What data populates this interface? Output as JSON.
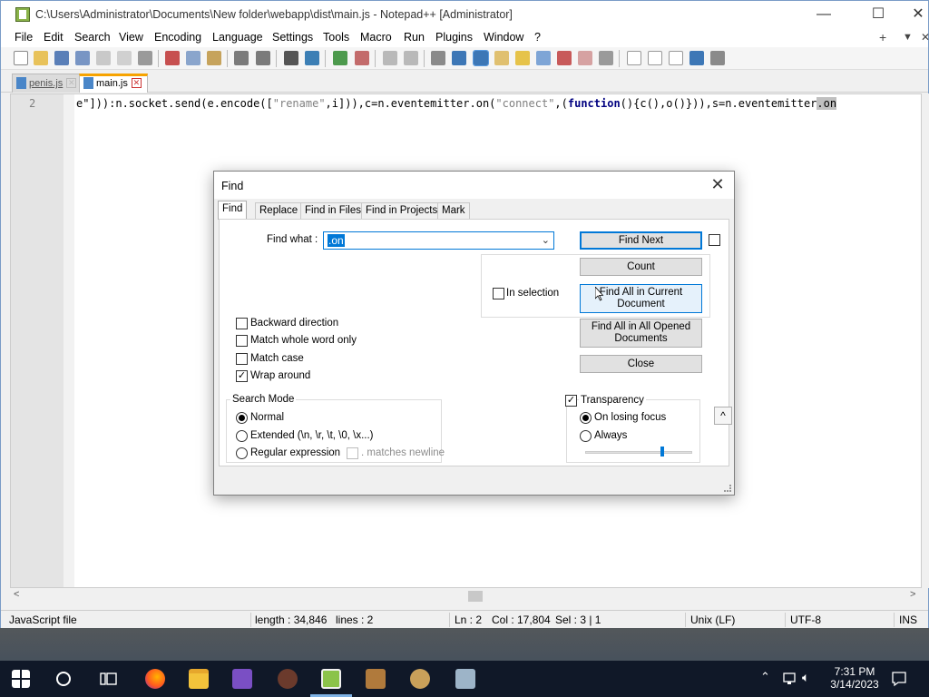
{
  "window": {
    "title": "C:\\Users\\Administrator\\Documents\\New folder\\webapp\\dist\\main.js - Notepad++ [Administrator]",
    "minimize": "—",
    "maximize": "☐",
    "close": "✕"
  },
  "menu": {
    "items": [
      "File",
      "Edit",
      "Search",
      "View",
      "Encoding",
      "Language",
      "Settings",
      "Tools",
      "Macro",
      "Run",
      "Plugins",
      "Window",
      "?"
    ],
    "plus": "+",
    "down": "▼",
    "close": "✕"
  },
  "tabs": [
    {
      "label": "penis.js",
      "active": false
    },
    {
      "label": "main.js",
      "active": true
    }
  ],
  "editor": {
    "line_number": "2",
    "code_prefix": "e\"])):n.socket.send(e.encode([",
    "code_str1": "\"rename\"",
    "code_mid1": ",i])),c=n.eventemitter.on(",
    "code_str2": "\"connect\"",
    "code_mid2": ",(",
    "code_kw": "function",
    "code_mid3": "(){c(),o()})),s=n.eventemitter",
    "code_hl": ".on"
  },
  "statusbar": {
    "filetype": "JavaScript file",
    "length": "length : 34,846",
    "lines": "lines : 2",
    "ln": "Ln : 2",
    "col": "Col : 17,804",
    "sel": "Sel : 3 | 1",
    "eol": "Unix (LF)",
    "encoding": "UTF-8",
    "mode": "INS"
  },
  "find_dialog": {
    "title": "Find",
    "close": "✕",
    "tabs": [
      "Find",
      "Replace",
      "Find in Files",
      "Find in Projects",
      "Mark"
    ],
    "find_what_label": "Find what :",
    "find_what_value": ".on",
    "in_selection": "In selection",
    "backward": "Backward direction",
    "whole_word": "Match whole word only",
    "match_case": "Match case",
    "wrap_around": "Wrap around",
    "search_mode_label": "Search Mode",
    "mode_normal": "Normal",
    "mode_extended": "Extended (\\n, \\r, \\t, \\0, \\x...)",
    "mode_regex": "Regular expression",
    "matches_newline": ". matches newline",
    "transparency": "Transparency",
    "on_losing_focus": "On losing focus",
    "always": "Always",
    "btn_find_next": "Find Next",
    "btn_count": "Count",
    "btn_find_all_current_1": "Find All in Current",
    "btn_find_all_current_2": "Document",
    "btn_find_all_opened_1": "Find All in All Opened",
    "btn_find_all_opened_2": "Documents",
    "btn_close": "Close",
    "collapse": "^",
    "checked": "✓",
    "transparency_level": 0.72
  },
  "taskbar": {
    "time": "7:31 PM",
    "date": "3/14/2023"
  }
}
